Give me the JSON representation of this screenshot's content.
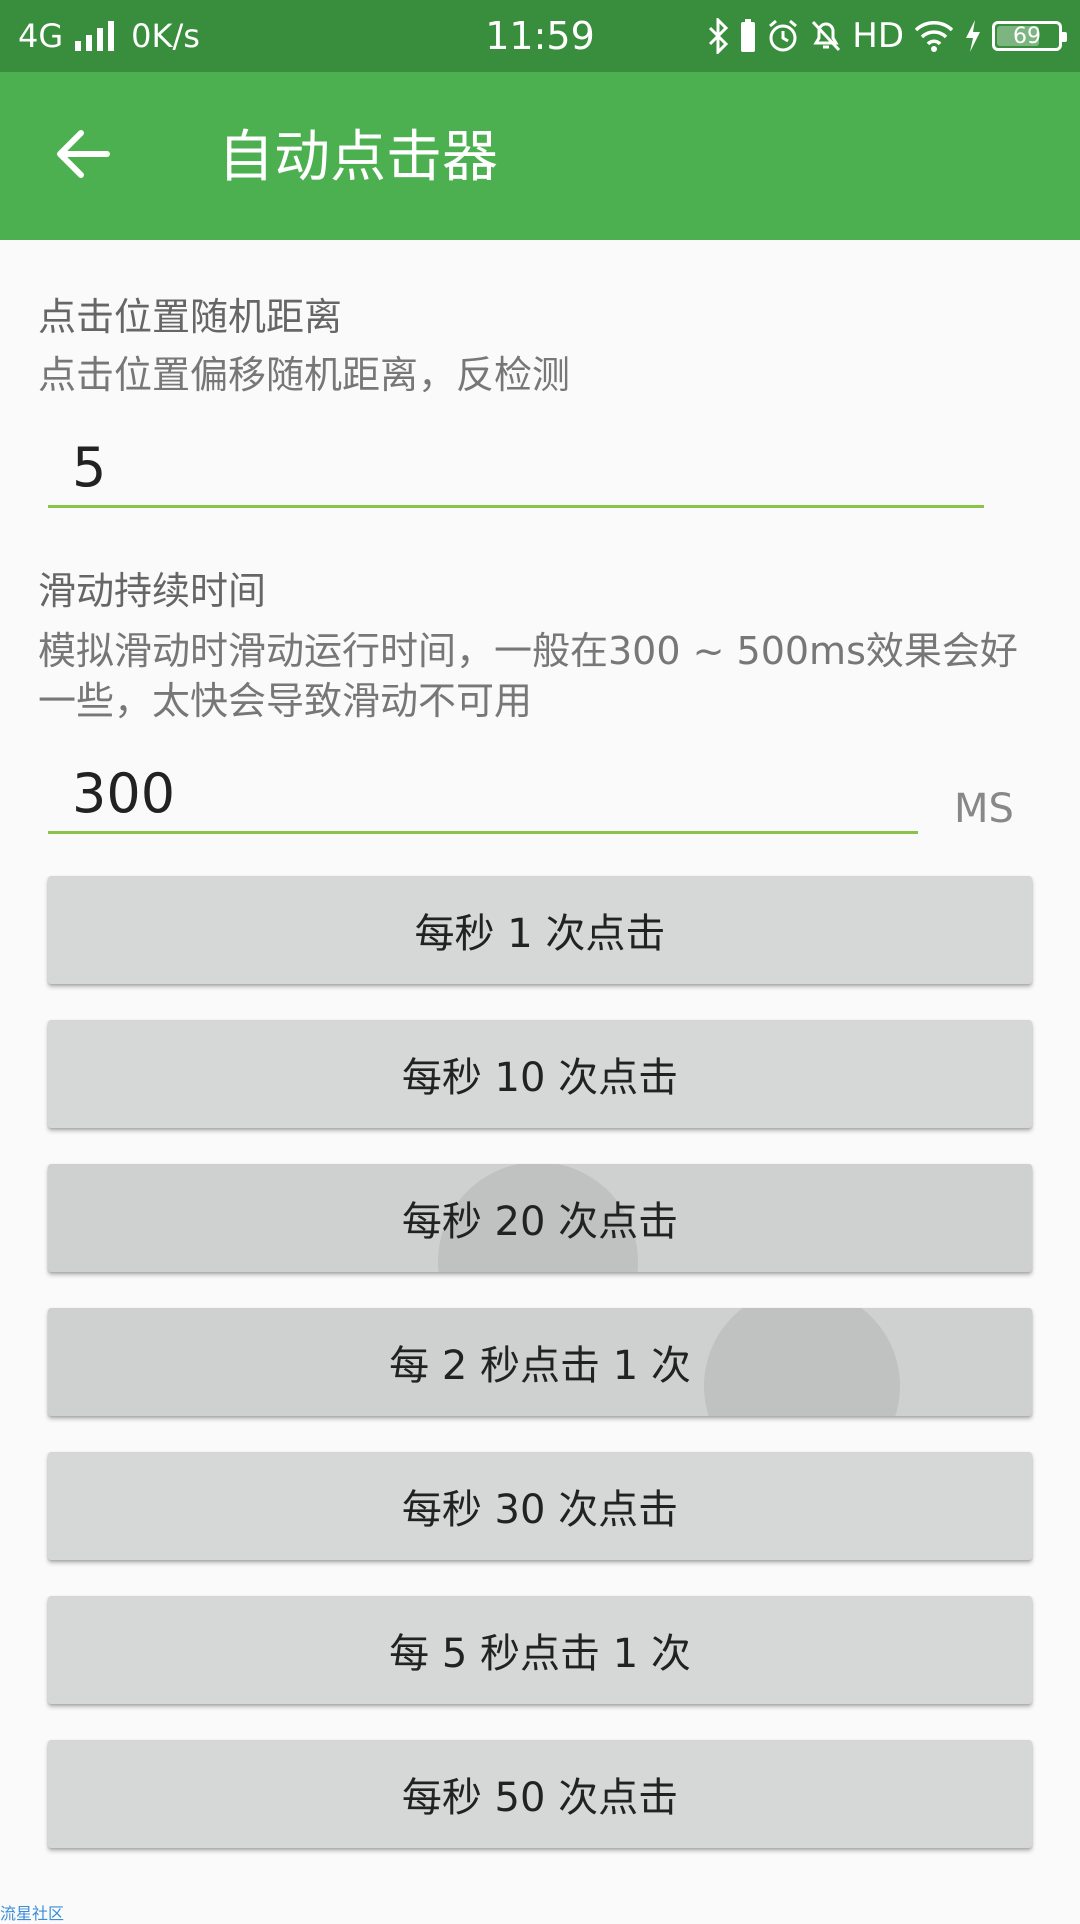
{
  "status_bar": {
    "network": "4G",
    "speed": "0K/s",
    "time": "11:59",
    "hd": "HD",
    "battery": "69"
  },
  "app_bar": {
    "title": "自动点击器"
  },
  "settings": {
    "random_distance": {
      "title": "点击位置随机距离",
      "description": "点击位置偏移随机距离，反检测",
      "value": "5"
    },
    "swipe_duration": {
      "title": "滑动持续时间",
      "description": "模拟滑动时滑动运行时间，一般在300 ~ 500ms效果会好一些，太快会导致滑动不可用",
      "value": "300",
      "unit": "MS"
    }
  },
  "buttons": [
    {
      "label": "每秒 1 次点击"
    },
    {
      "label": "每秒 10 次点击"
    },
    {
      "label": "每秒 20 次点击"
    },
    {
      "label": "每 2 秒点击 1 次"
    },
    {
      "label": "每秒 30 次点击"
    },
    {
      "label": "每 5 秒点击 1 次"
    },
    {
      "label": "每秒 50 次点击"
    }
  ],
  "watermark": "流星社区"
}
